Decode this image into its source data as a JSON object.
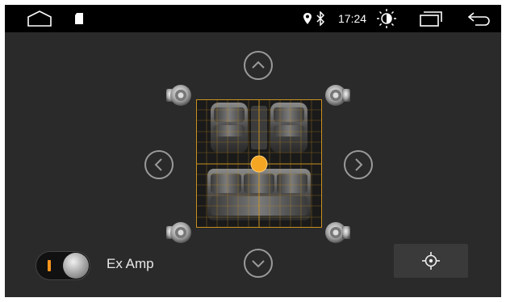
{
  "status_bar": {
    "time": "17:24",
    "icons": [
      "home-icon",
      "sd-card-icon",
      "location-icon",
      "bluetooth-icon",
      "brightness-icon",
      "recent-apps-icon",
      "back-icon"
    ]
  },
  "balance": {
    "up_icon": "chevron-up-icon",
    "down_icon": "chevron-down-icon",
    "left_icon": "chevron-left-icon",
    "right_icon": "chevron-right-icon",
    "speakers": [
      "front-left",
      "front-right",
      "rear-left",
      "rear-right"
    ],
    "accent_color": "#f5a623",
    "grid_color": "#c8901e"
  },
  "ex_amp": {
    "label": "Ex Amp",
    "indicator_color": "#f7941d"
  },
  "center_button": {
    "icon": "crosshair-icon"
  }
}
